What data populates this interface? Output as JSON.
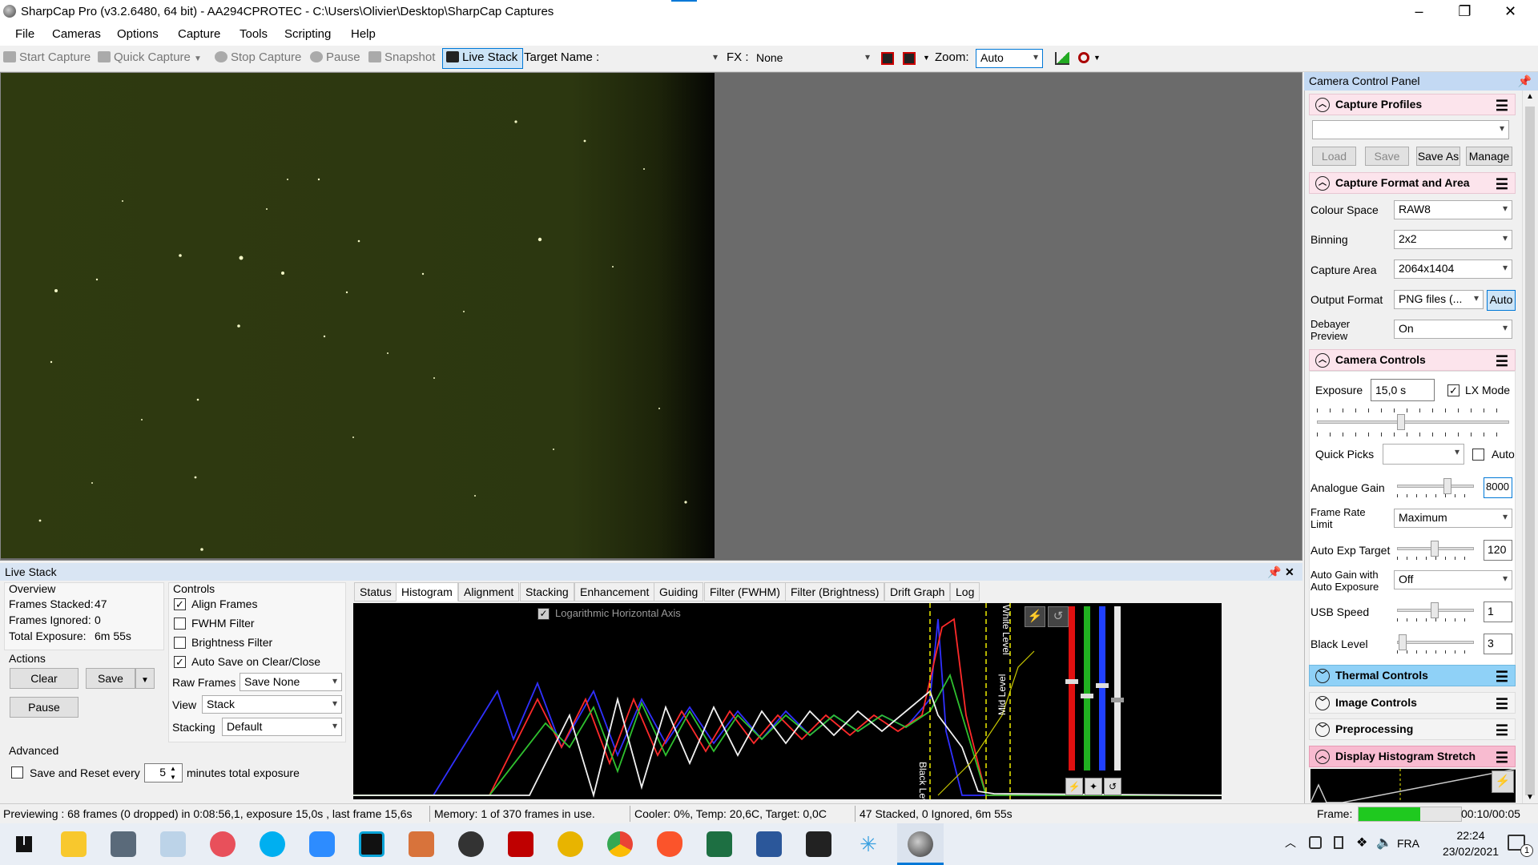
{
  "window": {
    "title": "SharpCap Pro (v3.2.6480, 64 bit) - AA294CPROTEC - C:\\Users\\Olivier\\Desktop\\SharpCap Captures",
    "minimize": "–",
    "maximize": "❐",
    "close": "✕"
  },
  "menu": [
    "File",
    "Cameras",
    "Options",
    "Capture",
    "Tools",
    "Scripting",
    "Help"
  ],
  "toolbar": {
    "start_capture": "Start Capture",
    "quick_capture": "Quick Capture",
    "stop_capture": "Stop Capture",
    "pause": "Pause",
    "snapshot": "Snapshot",
    "live_stack": "Live Stack",
    "target_name_label": "Target Name :",
    "fx_label": "FX :",
    "fx_value": "None",
    "zoom_label": "Zoom:",
    "zoom_value": "Auto"
  },
  "camera_panel": {
    "title": "Camera Control Panel",
    "capture_profiles": {
      "title": "Capture Profiles",
      "load": "Load",
      "save": "Save",
      "save_as": "Save As",
      "manage": "Manage"
    },
    "capture_format": {
      "title": "Capture Format and Area",
      "colour_space_label": "Colour Space",
      "colour_space": "RAW8",
      "binning_label": "Binning",
      "binning": "2x2",
      "capture_area_label": "Capture Area",
      "capture_area": "2064x1404",
      "output_format_label": "Output Format",
      "output_format": "PNG files (...",
      "auto": "Auto",
      "debayer_label_1": "Debayer",
      "debayer_label_2": "Preview",
      "debayer": "On"
    },
    "camera_controls": {
      "title": "Camera Controls",
      "exposure_label": "Exposure",
      "exposure": "15,0 s",
      "lx_mode": "LX Mode",
      "quick_picks_label": "Quick Picks",
      "auto": "Auto",
      "analogue_gain_label": "Analogue Gain",
      "analogue_gain": "8000",
      "frame_rate_label_1": "Frame Rate",
      "frame_rate_label_2": "Limit",
      "frame_rate": "Maximum",
      "auto_exp_label": "Auto Exp Target",
      "auto_exp": "120",
      "auto_gain_label_1": "Auto Gain with",
      "auto_gain_label_2": "Auto Exposure",
      "auto_gain": "Off",
      "usb_speed_label": "USB Speed",
      "usb_speed": "1",
      "black_level_label": "Black Level",
      "black_level": "3"
    },
    "thermal_controls": "Thermal Controls",
    "image_controls": "Image Controls",
    "preprocessing": "Preprocessing",
    "histogram_stretch": "Display Histogram Stretch"
  },
  "live_stack": {
    "title": "Live Stack",
    "overview_label": "Overview",
    "frames_stacked_label": "Frames Stacked:",
    "frames_stacked": "47",
    "frames_ignored_label": "Frames Ignored:",
    "frames_ignored": "0",
    "total_exposure_label": "Total Exposure:",
    "total_exposure": "6m 55s",
    "actions_label": "Actions",
    "clear": "Clear",
    "save": "Save",
    "pause": "Pause",
    "advanced_label": "Advanced",
    "save_reset_label": "Save and Reset every",
    "save_reset_value": "5",
    "minutes_label": "minutes total exposure",
    "controls_label": "Controls",
    "align_frames": "Align Frames",
    "fwhm_filter": "FWHM Filter",
    "brightness_filter": "Brightness Filter",
    "auto_save": "Auto Save on Clear/Close",
    "raw_frames_label": "Raw Frames",
    "raw_frames": "Save None",
    "view_label": "View",
    "view": "Stack",
    "stacking_label": "Stacking",
    "stacking": "Default",
    "tabs": [
      "Status",
      "Histogram",
      "Alignment",
      "Stacking",
      "Enhancement",
      "Guiding",
      "Filter (FWHM)",
      "Filter (Brightness)",
      "Drift Graph",
      "Log"
    ],
    "log_horizontal": "Logarithmic Horizontal Axis",
    "black_level_marker": "Black Level",
    "mid_level_marker": "Mid Level",
    "white_level_marker": "White Level"
  },
  "status_bar": {
    "previewing": "Previewing : 68 frames (0 dropped) in 0:08:56,1, exposure 15,0s , last frame 15,6s",
    "memory": "Memory: 1 of 370 frames in use.",
    "cooler": "Cooler: 0%, Temp: 20,6C, Target: 0,0C",
    "stacked": "47 Stacked, 0 Ignored, 6m 55s",
    "frame_label": "Frame:",
    "frame_time": "00:10/00:05",
    "frame_progress": 0.6
  },
  "taskbar": {
    "lang": "FRA",
    "time": "22:24",
    "date": "23/02/2021",
    "notifications": "1"
  },
  "colors": {
    "preview_bg": "#2f3a10",
    "histogram_bg": "#000000",
    "panel_pink": "#fce4ec",
    "panel_blue": "#8fd1f7",
    "accent_blue": "#0078d7",
    "progress_green": "#1fc91f"
  }
}
